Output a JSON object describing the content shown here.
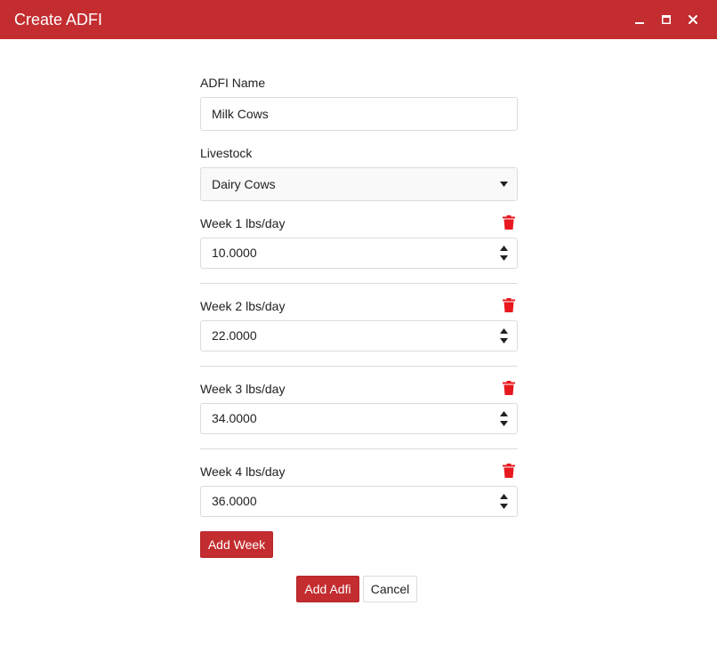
{
  "dialog": {
    "title": "Create ADFI",
    "minimize_icon": "minimize-icon",
    "maximize_icon": "maximize-icon",
    "close_icon": "close-icon"
  },
  "form": {
    "name_label": "ADFI Name",
    "name_value": "Milk Cows",
    "livestock_label": "Livestock",
    "livestock_value": "Dairy Cows",
    "weeks": [
      {
        "label": "Week 1 lbs/day",
        "value": "10.0000"
      },
      {
        "label": "Week 2 lbs/day",
        "value": "22.0000"
      },
      {
        "label": "Week 3 lbs/day",
        "value": "34.0000"
      },
      {
        "label": "Week 4 lbs/day",
        "value": "36.0000"
      }
    ],
    "add_week_label": "Add Week"
  },
  "footer": {
    "submit_label": "Add Adfi",
    "cancel_label": "Cancel"
  },
  "colors": {
    "accent": "#c32d30",
    "delete_icon": "#e8181f"
  }
}
